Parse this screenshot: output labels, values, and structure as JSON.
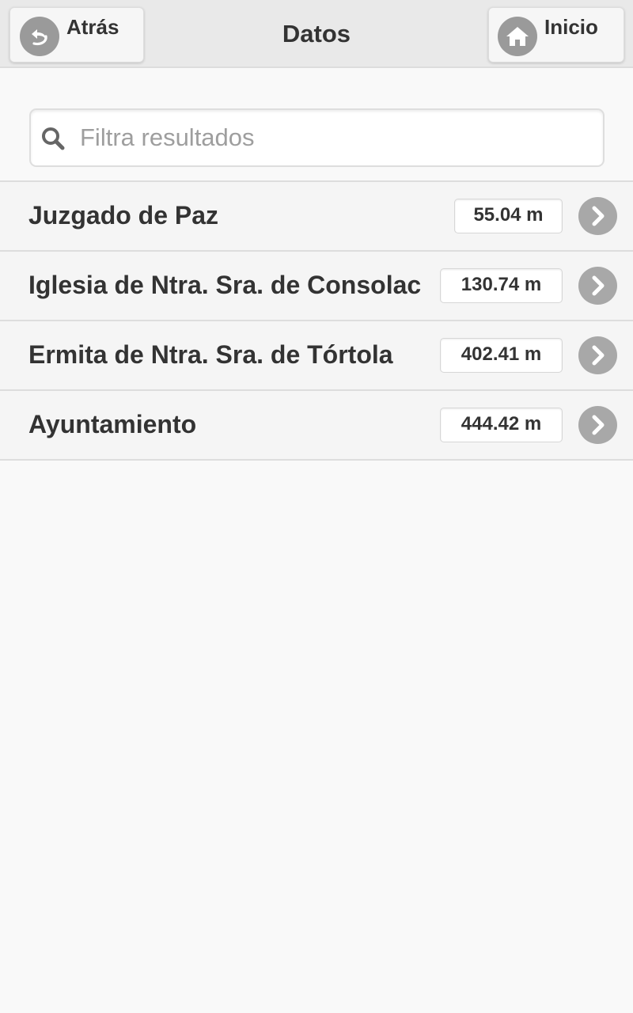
{
  "header": {
    "title": "Datos",
    "back_label": "Atrás",
    "home_label": "Inicio"
  },
  "search": {
    "placeholder": "Filtra resultados",
    "value": ""
  },
  "results": [
    {
      "name": "Juzgado de Paz",
      "distance": "55.04 m"
    },
    {
      "name": "Iglesia de Ntra. Sra. de Consolac",
      "distance": "130.74 m"
    },
    {
      "name": "Ermita de Ntra. Sra. de Tórtola",
      "distance": "402.41 m"
    },
    {
      "name": "Ayuntamiento",
      "distance": "444.42 m"
    }
  ],
  "icons": {
    "back": "back-arrow-icon",
    "home": "home-icon",
    "search": "search-icon",
    "row_arrow": "chevron-right-icon"
  },
  "colors": {
    "header_bg": "#e9e9e9",
    "page_bg": "#f9f9f9",
    "row_bg": "#f5f5f5",
    "icon_disc": "#9a9a9a",
    "text": "#333333"
  }
}
